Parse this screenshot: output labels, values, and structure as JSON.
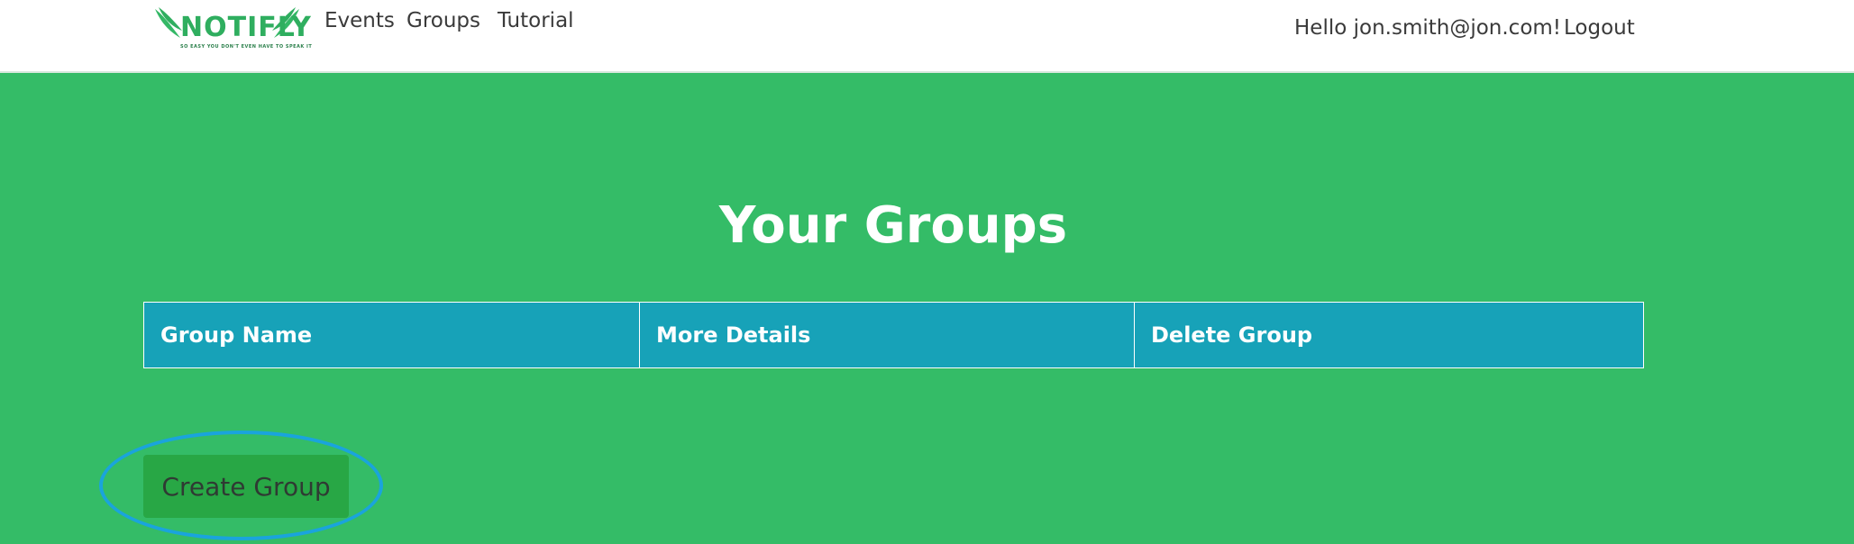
{
  "nav": {
    "logo_text": "NOTIFLY",
    "logo_tagline": "SO EASY YOU DON'T EVEN HAVE TO SPEAK IT",
    "links": [
      "Events",
      "Groups",
      "Tutorial"
    ],
    "greeting": "Hello jon.smith@jon.com!",
    "logout_label": "Logout"
  },
  "main": {
    "title": "Your Groups",
    "table": {
      "columns": [
        "Group Name",
        "More Details",
        "Delete Group"
      ],
      "rows": []
    },
    "create_button_label": "Create Group"
  },
  "colors": {
    "page_background": "#34bc67",
    "table_header": "#17a2b8",
    "button": "#28a745",
    "annotation_ring": "#1aa4dc"
  }
}
